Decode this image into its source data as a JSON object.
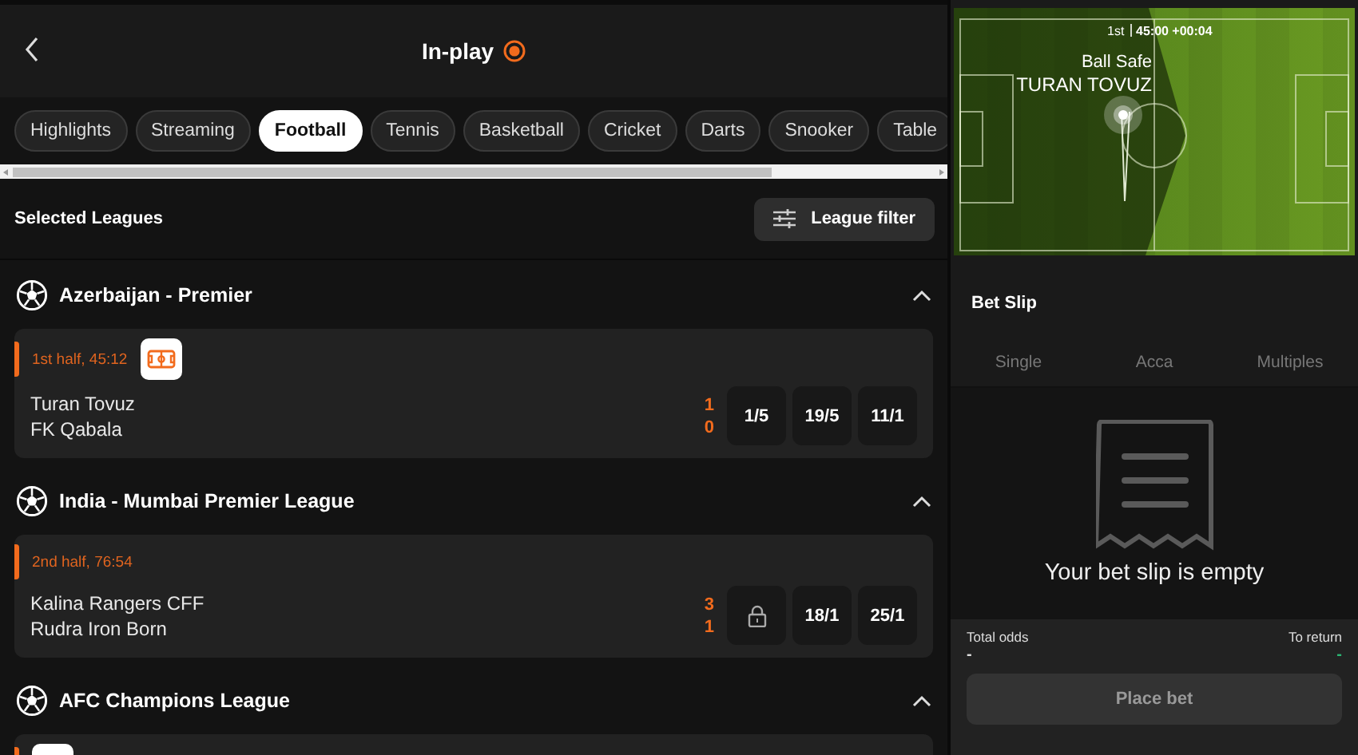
{
  "header": {
    "title": "In-play",
    "live": true
  },
  "sports": [
    {
      "label": "Highlights",
      "selected": false
    },
    {
      "label": "Streaming",
      "selected": false
    },
    {
      "label": "Football",
      "selected": true
    },
    {
      "label": "Tennis",
      "selected": false
    },
    {
      "label": "Basketball",
      "selected": false
    },
    {
      "label": "Cricket",
      "selected": false
    },
    {
      "label": "Darts",
      "selected": false
    },
    {
      "label": "Snooker",
      "selected": false
    },
    {
      "label": "Table",
      "selected": false
    }
  ],
  "leagues_bar": {
    "title": "Selected Leagues",
    "filter_button": "League filter"
  },
  "leagues": [
    {
      "name": "Azerbaijan - Premier",
      "expanded": true,
      "matches": [
        {
          "period": "1st half, 45:12",
          "pitch_view": true,
          "teams": [
            {
              "name": "Turan Tovuz",
              "score": "1"
            },
            {
              "name": "FK Qabala",
              "score": "0"
            }
          ],
          "odds": [
            {
              "kind": "price",
              "value": "1/5"
            },
            {
              "kind": "price",
              "value": "19/5"
            },
            {
              "kind": "price",
              "value": "11/1"
            }
          ]
        }
      ]
    },
    {
      "name": "India - Mumbai Premier League",
      "expanded": true,
      "matches": [
        {
          "period": "2nd half, 76:54",
          "pitch_view": false,
          "teams": [
            {
              "name": "Kalina Rangers CFF",
              "score": "3"
            },
            {
              "name": "Rudra Iron Born",
              "score": "1"
            }
          ],
          "odds": [
            {
              "kind": "locked"
            },
            {
              "kind": "price",
              "value": "18/1"
            },
            {
              "kind": "price",
              "value": "25/1"
            }
          ]
        }
      ]
    },
    {
      "name": "AFC Champions League",
      "expanded": true,
      "matches": [
        {
          "pitch_view": true
        }
      ]
    }
  ],
  "pitch": {
    "half": "1st",
    "clock": "45:00 +00:04",
    "status": "Ball Safe",
    "team": "TURAN TOVUZ"
  },
  "bet_slip": {
    "title": "Bet Slip",
    "tabs": [
      "Single",
      "Acca",
      "Multiples"
    ],
    "empty_message": "Your bet slip is empty",
    "total_odds_label": "Total odds",
    "total_odds": "-",
    "return_label": "To return",
    "return_value": "-",
    "place_button": "Place bet"
  }
}
